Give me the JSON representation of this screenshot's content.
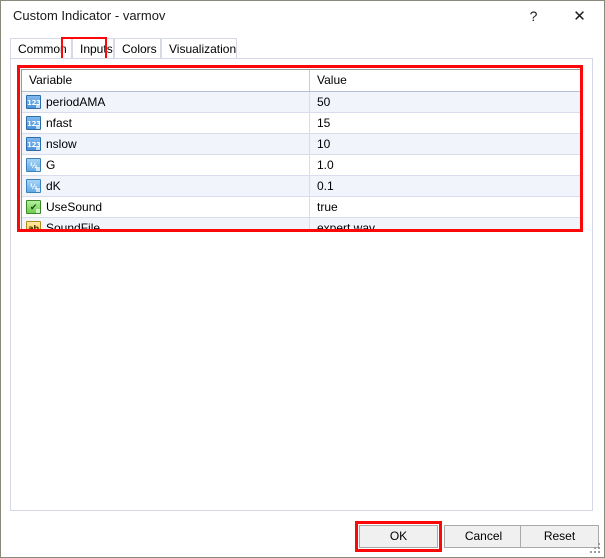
{
  "window": {
    "title": "Custom Indicator - varmov",
    "help_label": "?",
    "close_label": "✕"
  },
  "tabs": [
    {
      "label": "Common",
      "selected": false
    },
    {
      "label": "Inputs",
      "selected": true
    },
    {
      "label": "Colors",
      "selected": false
    },
    {
      "label": "Visualization",
      "selected": false
    }
  ],
  "grid": {
    "columns": [
      "Variable",
      "Value"
    ],
    "rows": [
      {
        "icon": "int-type-icon",
        "icon_glyph": "123",
        "variable": "periodAMA",
        "value": "50"
      },
      {
        "icon": "int-type-icon",
        "icon_glyph": "123",
        "variable": "nfast",
        "value": "15"
      },
      {
        "icon": "int-type-icon",
        "icon_glyph": "123",
        "variable": "nslow",
        "value": "10"
      },
      {
        "icon": "double-type-icon",
        "icon_glyph": "½",
        "variable": "G",
        "value": "1.0"
      },
      {
        "icon": "double-type-icon",
        "icon_glyph": "½",
        "variable": "dK",
        "value": "0.1"
      },
      {
        "icon": "bool-type-icon",
        "icon_glyph": "✔",
        "variable": "UseSound",
        "value": "true"
      },
      {
        "icon": "string-type-icon",
        "icon_glyph": "ab",
        "variable": "SoundFile",
        "value": "expert.wav"
      }
    ]
  },
  "footer": {
    "ok_label": "OK",
    "cancel_label": "Cancel",
    "reset_label": "Reset"
  },
  "highlights": {
    "accent_color": "#fb0808",
    "targets": [
      "inputs-tab",
      "inputs-grid",
      "ok-button"
    ]
  }
}
